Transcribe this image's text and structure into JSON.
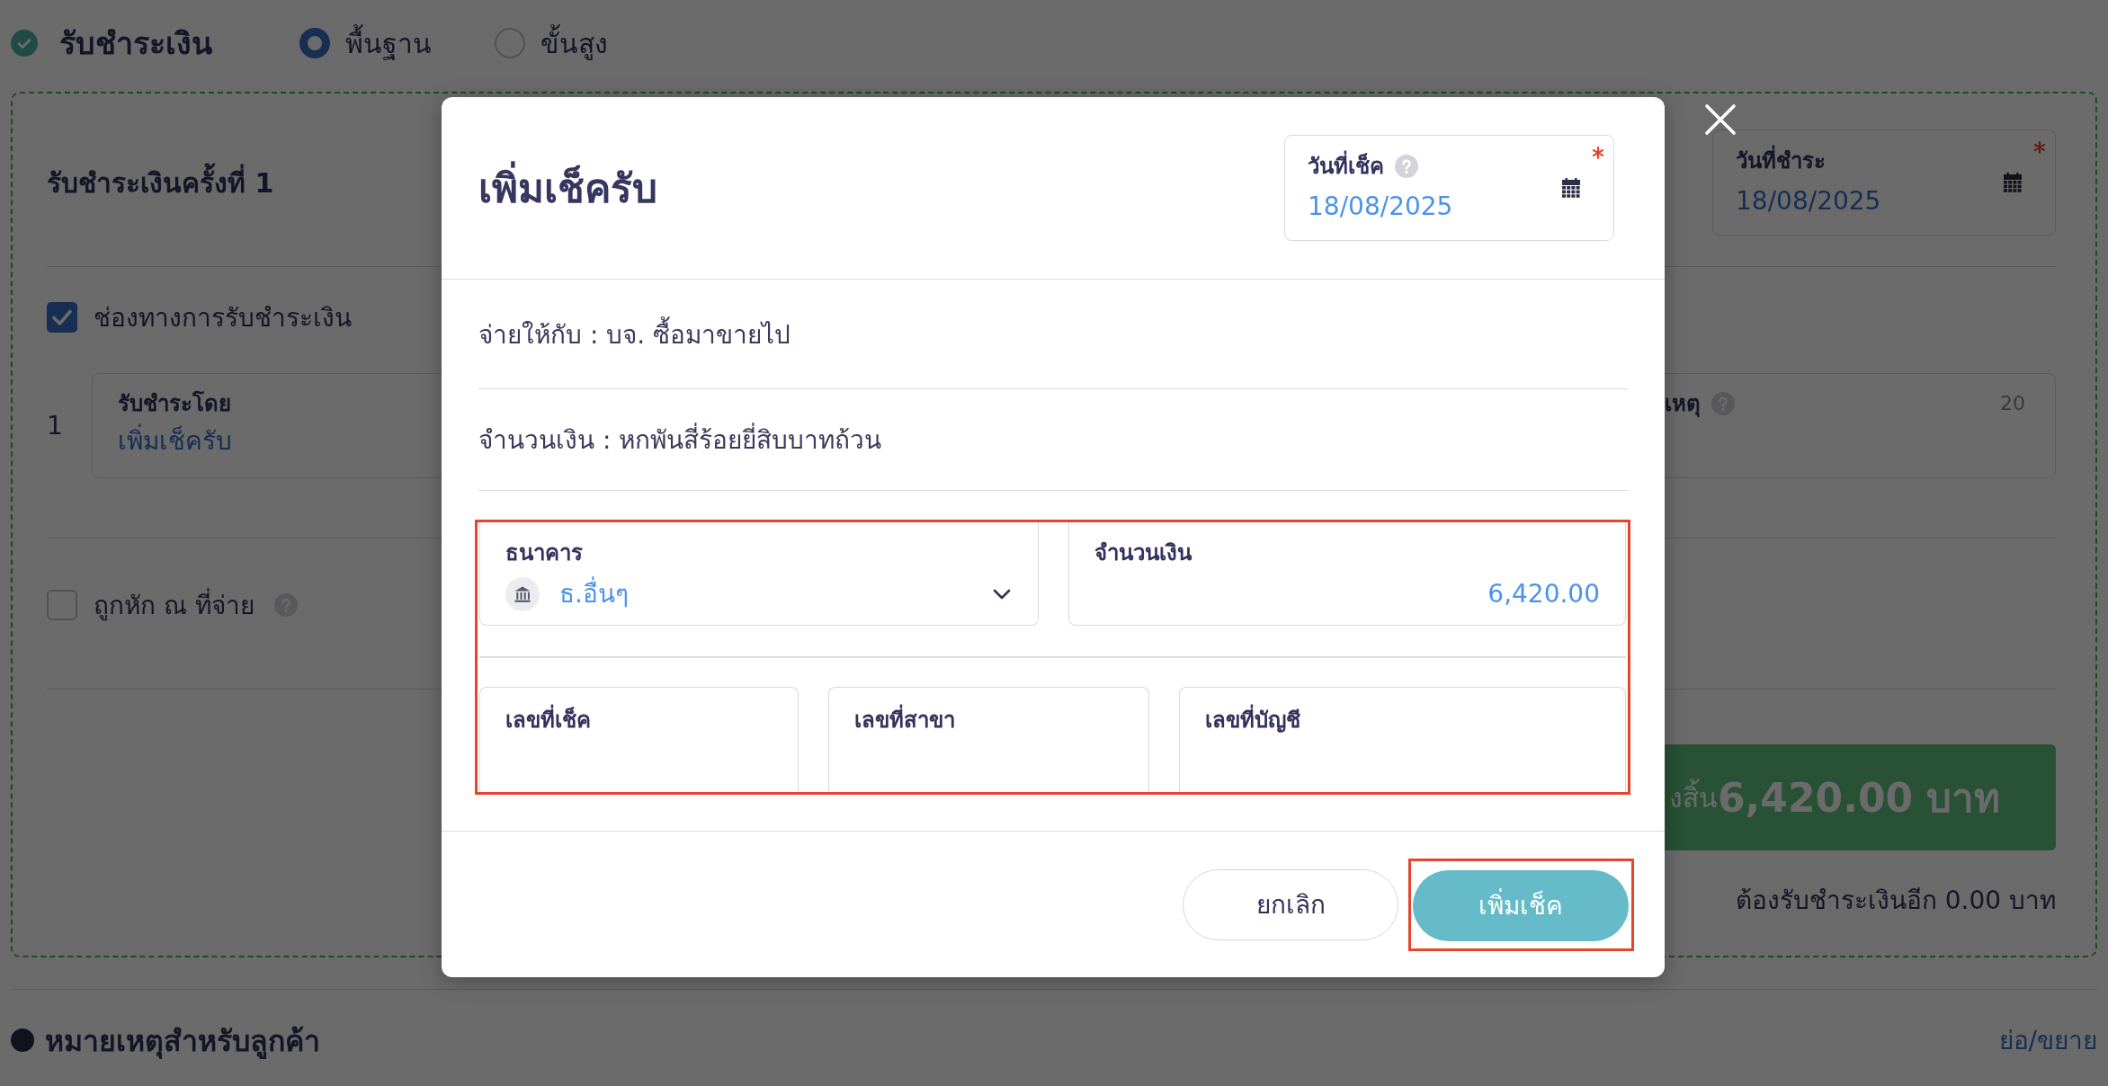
{
  "page": {
    "header": {
      "title": "รับชำระเงิน",
      "done": true,
      "modes": [
        {
          "label": "พื้นฐาน",
          "selected": true
        },
        {
          "label": "ขั้นสูง",
          "selected": false
        }
      ]
    },
    "payment": {
      "title": "รับชำระเงินครั้งที่ 1",
      "date_field": {
        "label": "วันที่ชำระ",
        "value": "18/08/2025",
        "required": true
      },
      "channel_option": {
        "label": "ช่องทางการรับชำระเงิน",
        "checked": true
      },
      "lines": [
        {
          "number": "1",
          "method": {
            "label": "รับชำระโดย",
            "link": "เพิ่มเช็ครับ"
          },
          "note": {
            "label": "เหตุ",
            "help": true,
            "counter": "20"
          }
        }
      ],
      "withholding_option": {
        "label": "ถูกหัก ณ ที่จ่าย",
        "checked": false,
        "help": true
      },
      "total": {
        "label": "งสิ้น",
        "amount": "6,420.00 บาท"
      },
      "remaining": "ต้องรับชำระเงินอีก 0.00 บาท"
    },
    "customer_note": {
      "title": "หมายเหตุสำหรับลูกค้า",
      "toggle": "ย่อ/ขยาย"
    }
  },
  "dialog": {
    "title": "เพิ่มเช็ครับ",
    "date_field": {
      "label": "วันที่เช็ค",
      "help": true,
      "value": "18/08/2025",
      "required": true
    },
    "info_lines": [
      "จ่ายให้กับ : บจ. ซื้อมาขายไป",
      "จำนวนเงิน : หกพันสี่ร้อยยี่สิบบาทถ้วน"
    ],
    "form": {
      "highlighted": true,
      "rows": [
        {
          "fields": [
            {
              "kind": "select",
              "label": "ธนาคาร",
              "value": "ธ.อื่นๆ"
            },
            {
              "kind": "amount",
              "label": "จำนวนเงิน",
              "value": "6,420.00"
            }
          ]
        },
        {
          "fields": [
            {
              "kind": "text",
              "label": "เลขที่เช็ค"
            },
            {
              "kind": "text",
              "label": "เลขที่สาขา"
            },
            {
              "kind": "text",
              "label": "เลขที่บัญชี"
            }
          ]
        }
      ]
    },
    "buttons": [
      {
        "kind": "secondary",
        "label": "ยกเลิก",
        "highlighted": false
      },
      {
        "kind": "primary",
        "label": "เพิ่มเช็ค",
        "highlighted": true
      }
    ]
  }
}
